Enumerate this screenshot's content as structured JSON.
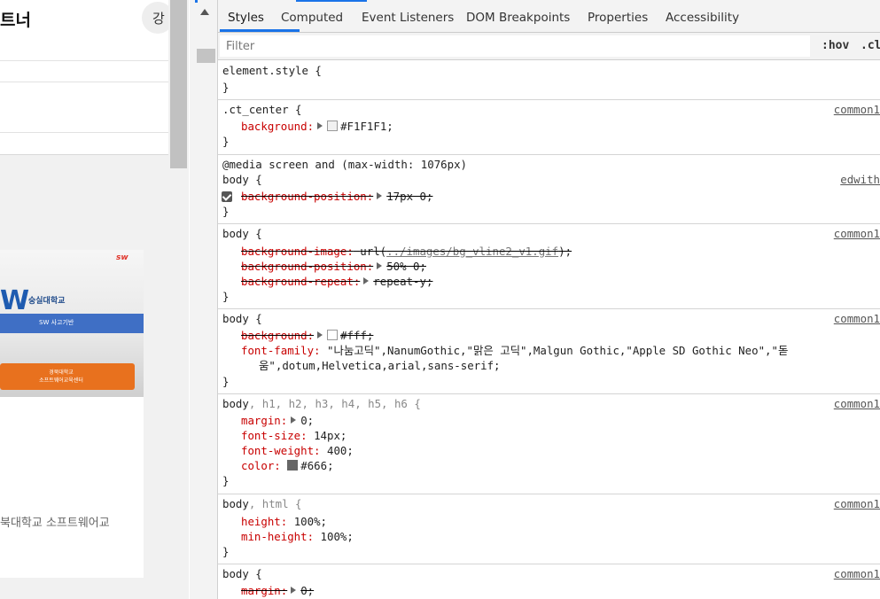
{
  "page": {
    "header_title": "트너",
    "header_circle_label": "강",
    "banner": {
      "logo": "sw",
      "big_text": "W",
      "university": "숭실대학교",
      "blue_bar": "SW 사고기반",
      "orange_lines": "경북대학교\n소프트웨어교육센터"
    },
    "caption": "북대학교 소프트웨어교"
  },
  "devtools": {
    "tabs": [
      {
        "label": "Styles",
        "active": true
      },
      {
        "label": "Computed"
      },
      {
        "label": "Event Listeners"
      },
      {
        "label": "DOM Breakpoints"
      },
      {
        "label": "Properties"
      },
      {
        "label": "Accessibility"
      }
    ],
    "filter_placeholder": "Filter",
    "hov_label": ":hov",
    "cls_label": ".cl",
    "rules": [
      {
        "selector": "element.style {",
        "close": "}"
      },
      {
        "selector": ".ct_center {",
        "source": "common1",
        "props": [
          {
            "name": "background:",
            "value": "#F1F1F1;",
            "swatch": "#F1F1F1",
            "arrow": true
          }
        ]
      },
      {
        "media": "@media screen and (max-width: 1076px)",
        "selector": "body {",
        "source": "edwith",
        "props": [
          {
            "name": "background-position:",
            "value": "17px 0;",
            "arrow": true,
            "struck": true,
            "checked": true
          }
        ]
      },
      {
        "selector": "body {",
        "source": "common1",
        "props": [
          {
            "name": "background-image:",
            "value_pre": "url(",
            "value_link": "../images/bg_vline2_v1.gif",
            "value_post": ");",
            "struck": true
          },
          {
            "name": "background-position:",
            "value": "50% 0;",
            "arrow": true,
            "struck": true
          },
          {
            "name": "background-repeat:",
            "value": "repeat-y;",
            "arrow": true,
            "struck": true
          }
        ]
      },
      {
        "selector": "body {",
        "source": "common1",
        "props": [
          {
            "name": "background:",
            "value": "#fff;",
            "swatch": "#ffffff",
            "arrow": true,
            "struck": true
          },
          {
            "name": "font-family:",
            "value": "\"나눔고딕\",NanumGothic,\"맑은 고딕\",Malgun Gothic,\"Apple SD Gothic Neo\",\"돋",
            "cont": "움\",dotum,Helvetica,arial,sans-serif;"
          }
        ]
      },
      {
        "selector_main": "body",
        "selector_rest": ", h1, h2, h3, h4, h5, h6 {",
        "source": "common1",
        "props": [
          {
            "name": "margin:",
            "value": "0;",
            "arrow": true
          },
          {
            "name": "font-size:",
            "value": "14px;"
          },
          {
            "name": "font-weight:",
            "value": "400;"
          },
          {
            "name": "color:",
            "value": "#666;",
            "swatch": "#666666"
          }
        ]
      },
      {
        "selector_main": "body",
        "selector_rest": ", html {",
        "source": "common1",
        "props": [
          {
            "name": "height:",
            "value": "100%;"
          },
          {
            "name": "min-height:",
            "value": "100%;"
          }
        ]
      },
      {
        "selector": "body {",
        "source": "common1",
        "props": [
          {
            "name": "margin:",
            "value": "0;",
            "arrow": true,
            "struck": true
          }
        ]
      }
    ]
  }
}
